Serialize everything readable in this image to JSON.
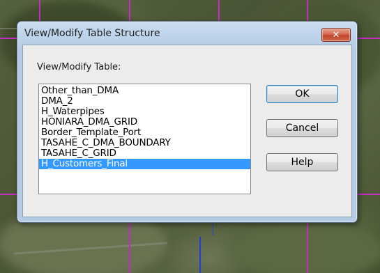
{
  "dialog": {
    "title": "View/Modify Table Structure",
    "close_symbol": "✕",
    "list_label": "View/Modify Table:",
    "tables": [
      "Other_than_DMA",
      "DMA_2",
      "H_Waterpipes",
      "HONIARA_DMA_GRID",
      "Border_Template_Port",
      "TASAHE_C_DMA_BOUNDARY",
      "TASAHE_C_GRID",
      "H_Customers_Final"
    ],
    "selected_index": 7,
    "buttons": {
      "ok": "OK",
      "cancel": "Cancel",
      "help": "Help"
    }
  },
  "colors": {
    "selection": "#3399ff",
    "grid_lines": "#c22fbf",
    "pipe_lines": "#2a3ad8"
  }
}
